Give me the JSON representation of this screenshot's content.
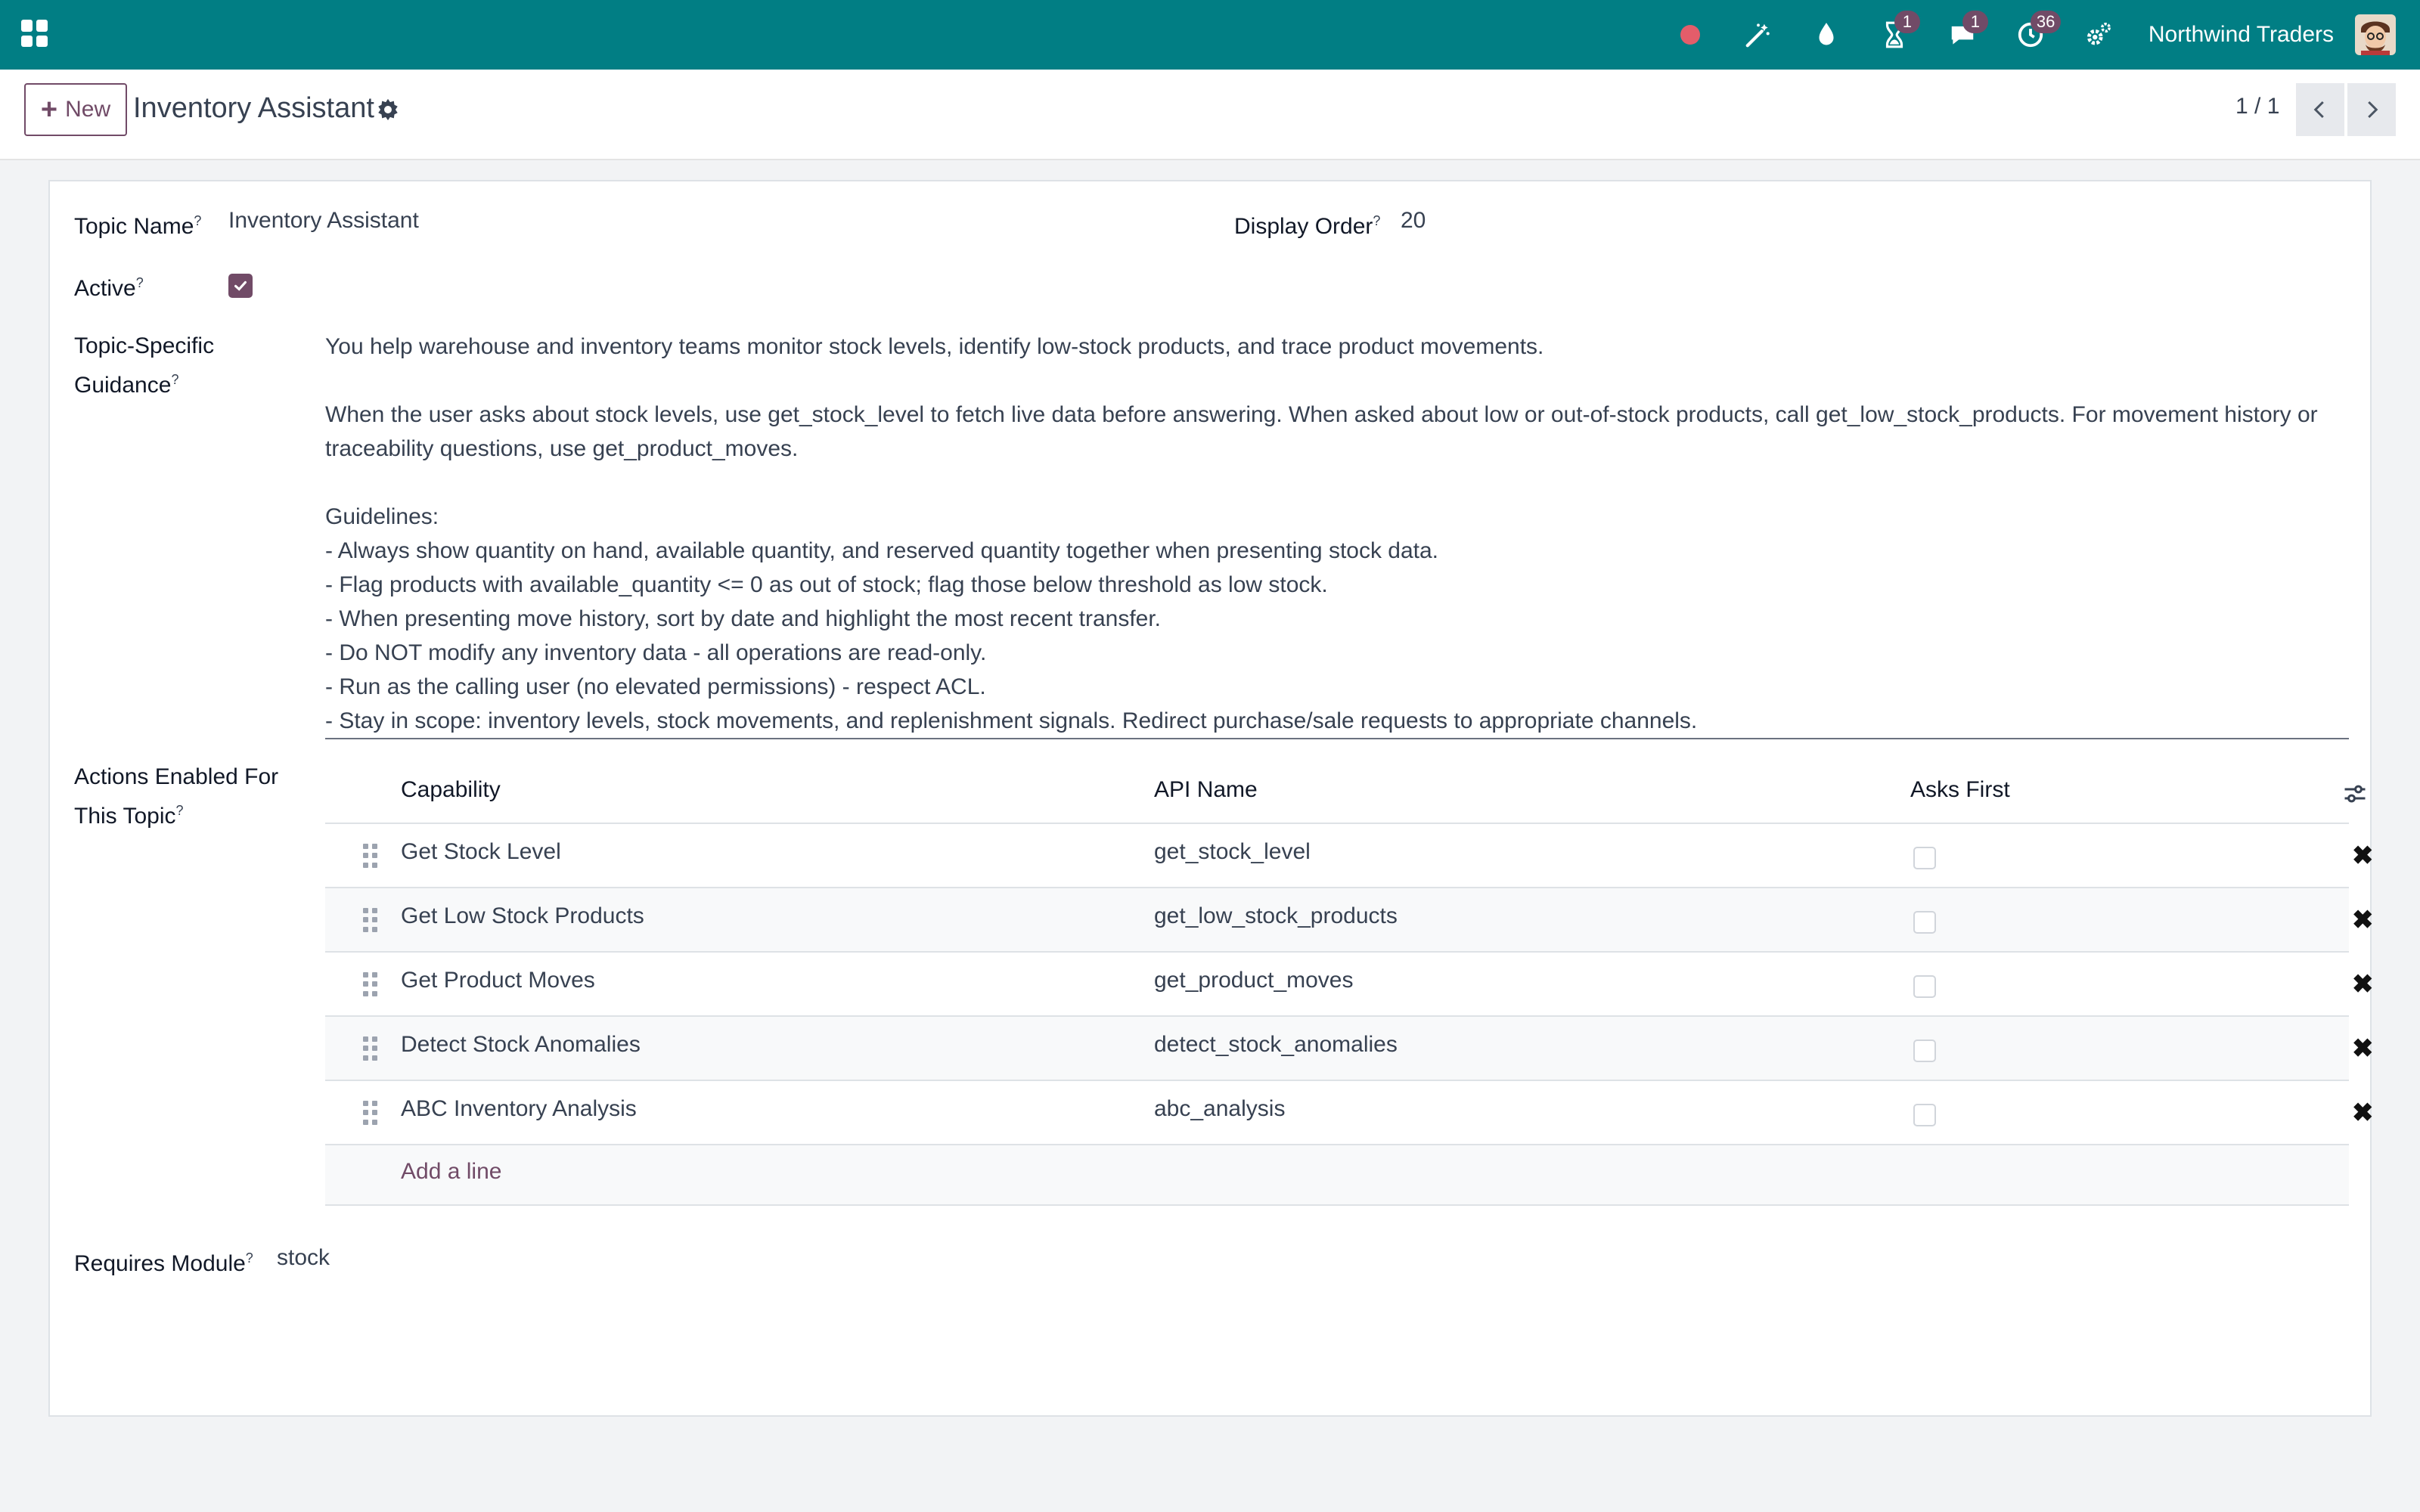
{
  "navbar": {
    "company": "Northwind Traders",
    "icons": [
      "record-dot",
      "magic-wand-icon",
      "drop-icon",
      "hourglass-icon",
      "chat-icon",
      "activity-clock-icon",
      "settings-gears-icon"
    ],
    "badges": {
      "hourglass": "1",
      "chat": "1",
      "activity": "36"
    },
    "accent": "#017e84"
  },
  "control": {
    "new_label": "New",
    "title": "Inventory Assistant",
    "pager": "1 / 1"
  },
  "form": {
    "topic_name_label": "Topic Name",
    "topic_name_value": "Inventory Assistant",
    "display_order_label": "Display Order",
    "display_order_value": "20",
    "active_label": "Active",
    "active": true,
    "guidance_label_1": "Topic-Specific",
    "guidance_label_2": "Guidance",
    "guidance_lines": [
      "You help warehouse and inventory teams monitor stock levels, identify low-stock products, and trace product movements.",
      "",
      "When the user asks about stock levels, use get_stock_level to fetch live data before answering. When asked about low or out-of-stock products, call get_low_stock_products. For movement history or",
      "traceability questions, use get_product_moves.",
      "",
      "Guidelines:",
      "- Always show quantity on hand, available quantity, and reserved quantity together when presenting stock data.",
      "- Flag products with available_quantity <= 0 as out of stock; flag those below threshold as low stock.",
      "- When presenting move history, sort by date and highlight the most recent transfer.",
      "- Do NOT modify any inventory data - all operations are read-only.",
      "- Run as the calling user (no elevated permissions) - respect ACL.",
      "- Stay in scope: inventory levels, stock movements, and replenishment signals. Redirect purchase/sale requests to appropriate channels."
    ],
    "actions_label_1": "Actions Enabled For",
    "actions_label_2": "This Topic",
    "table": {
      "headers": {
        "capability": "Capability",
        "api_name": "API Name",
        "asks_first": "Asks First"
      },
      "rows": [
        {
          "capability": "Get Stock Level",
          "api_name": "get_stock_level",
          "asks_first": false
        },
        {
          "capability": "Get Low Stock Products",
          "api_name": "get_low_stock_products",
          "asks_first": false
        },
        {
          "capability": "Get Product Moves",
          "api_name": "get_product_moves",
          "asks_first": false
        },
        {
          "capability": "Detect Stock Anomalies",
          "api_name": "detect_stock_anomalies",
          "asks_first": false
        },
        {
          "capability": "ABC Inventory Analysis",
          "api_name": "abc_analysis",
          "asks_first": false
        }
      ],
      "add_line": "Add a line"
    },
    "requires_module_label": "Requires Module",
    "requires_module_value": "stock",
    "help_mark": "?"
  }
}
